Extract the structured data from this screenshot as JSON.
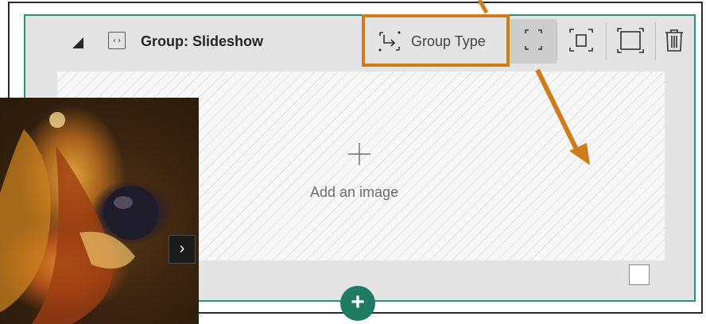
{
  "group": {
    "title": "Group: Slideshow",
    "type_label": "Group Type"
  },
  "canvas": {
    "add_image_label": "Add an image",
    "plus_glyph": "+"
  },
  "photo": {
    "next_glyph": "›"
  },
  "add_section": {
    "glyph": "+"
  },
  "icons": {
    "collapse": "collapse-triangle-icon",
    "code": "code-icon",
    "group_type": "group-type-icon",
    "layout_small": "layout-small-icon",
    "layout_medium": "layout-medium-icon",
    "layout_large": "layout-large-icon",
    "delete": "trash-icon"
  },
  "colors": {
    "accent_teal": "#2f8f7f",
    "add_button": "#1f7a62",
    "callout_orange": "#d07c1b"
  }
}
